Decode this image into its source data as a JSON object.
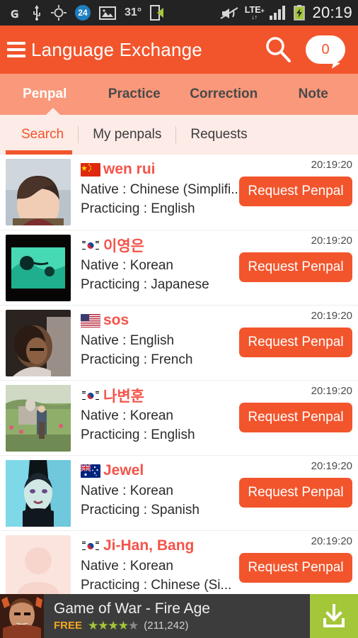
{
  "statusbar": {
    "left_icons": [
      "g-logo-icon",
      "usb-icon",
      "gps-crosshair-icon",
      "badge-24-icon",
      "gallery-image-icon",
      "temperature-label",
      "screen-share-icon"
    ],
    "temperature": "31°",
    "network": "LTE",
    "network_sup": "+",
    "badge_count": "24",
    "right_icons": [
      "vibrate-mute-icon",
      "lte-plus-icon",
      "signal-bars-icon",
      "battery-charging-icon"
    ],
    "clock": "20:19"
  },
  "appbar": {
    "title": "Language Exchange",
    "menu_icon": "hamburger-menu-icon",
    "search_icon": "search-icon",
    "message_icon": "message-bubble-icon",
    "message_count": "0",
    "bg": "#f2552c"
  },
  "main_tabs": [
    {
      "label": "Penpal",
      "active": true
    },
    {
      "label": "Practice",
      "active": false
    },
    {
      "label": "Correction",
      "active": false
    },
    {
      "label": "Note",
      "active": false
    }
  ],
  "sub_tabs": [
    {
      "label": "Search",
      "active": true
    },
    {
      "label": "My penpals",
      "active": false
    },
    {
      "label": "Requests",
      "active": false
    }
  ],
  "list": [
    {
      "name": "wen rui",
      "flag": "cn",
      "native": "Native : Chinese (Simplifi...",
      "practicing": "Practicing : English",
      "time": "20:19:20",
      "button": "Request Penpal",
      "avatar": "photo-woman-portrait"
    },
    {
      "name": "이영은",
      "flag": "kr",
      "native": "Native : Korean",
      "practicing": "Practicing : Japanese",
      "time": "20:19:20",
      "button": "Request Penpal",
      "avatar": "photo-underwater-dark"
    },
    {
      "name": "sos",
      "flag": "us",
      "native": "Native : English",
      "practicing": "Practicing : French",
      "time": "20:19:20",
      "button": "Request Penpal",
      "avatar": "photo-curly-hair-person"
    },
    {
      "name": "나변훈",
      "flag": "kr",
      "native": "Native : Korean",
      "practicing": "Practicing : English",
      "time": "20:19:20",
      "button": "Request Penpal",
      "avatar": "photo-man-garden-fountain"
    },
    {
      "name": "Jewel",
      "flag": "au",
      "native": "Native : Korean",
      "practicing": "Practicing : Spanish",
      "time": "20:19:20",
      "button": "Request Penpal",
      "avatar": "photo-person-blue-light"
    },
    {
      "name": "Ji-Han, Bang",
      "flag": "kr",
      "native": "Native : Korean",
      "practicing": "Practicing : Chinese (Si...",
      "time": "20:19:20",
      "button": "Request Penpal",
      "avatar": "placeholder-default-avatar"
    }
  ],
  "ad": {
    "title": "Game of War - Fire Age",
    "price": "FREE",
    "stars_filled": 4,
    "stars_total": 5,
    "rating_count": "(211,242)",
    "cta_icon": "download-icon",
    "cta_color": "#a4c639",
    "icon": "game-of-war-app-icon"
  },
  "colors": {
    "accent": "#f2552c",
    "tab_bar": "#f9987a",
    "subtab_bar": "#fcebe6",
    "name_text": "#f4544a",
    "ad_bg": "#3c3c3c"
  }
}
